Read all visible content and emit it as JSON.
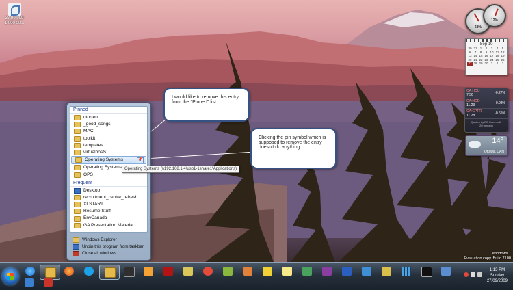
{
  "desktop": {
    "icon_caption_1": "37 99 999",
    "icon_caption_2": "1 000 00..."
  },
  "jumplist": {
    "pinned_header": "Pinned",
    "pinned": [
      "utorrent",
      "_good_songs",
      "MAC",
      "toolkit",
      "templates",
      "virtualhosts",
      "Operating Systems",
      "Operating Systems",
      "OPS"
    ],
    "frequent_header": "Frequent",
    "frequent": [
      "Desktop",
      "recruitment_centre_refresh",
      "XLSTART",
      "Resume Stuff",
      "EnvCanada",
      "GA Presentation Material"
    ],
    "tasks": [
      "Windows Explorer",
      "Unpin this program from taskbar",
      "Close all windows"
    ],
    "pin_glyph": "📌"
  },
  "tooltip": "Operating Systems (\\\\192.168.1.4\\usb1-1share1\\Applications)",
  "callouts": {
    "first": "I would like to remove this entry from the \"Pinned\" list.",
    "second": "Clicking the pin symbol which is supposed to remove the entry doesn't do anything."
  },
  "gadgets": {
    "gauge1_label": "68%",
    "gauge2_label": "12%",
    "calendar_header": "Sep 10",
    "calendar_days": [
      "30",
      "31",
      "1",
      "2",
      "3",
      "4",
      "5",
      "6",
      "7",
      "8",
      "9",
      "10",
      "11",
      "12",
      "13",
      "14",
      "15",
      "16",
      "17",
      "18",
      "19",
      "20",
      "21",
      "22",
      "23",
      "24",
      "25",
      "26",
      "27",
      "28",
      "29",
      "30",
      "1",
      "2",
      "3"
    ],
    "stocks": [
      {
        "symbol": "CA:HOU",
        "price": "7.56",
        "pct": "-0.27%"
      },
      {
        "symbol": "CA:HOD",
        "price": "11.23",
        "pct": "-0.08%"
      },
      {
        "symbol": "CA:CPTR",
        "price": "11.28",
        "pct": "-0.65%"
      }
    ],
    "stocks_footer": "Quotes by BC Commodit",
    "stocks_time": "20 min ago",
    "weather_temp": "14°",
    "weather_city": "Ottawa, CAN"
  },
  "watermark": {
    "line1": "Windows 7",
    "line2": "Evaluation copy. Build 7100"
  },
  "taskbar": {
    "time": "1:13 PM",
    "day": "Sunday",
    "date": "27/09/2009"
  },
  "colors": {
    "callout_border": "#365282",
    "highlight": "#c8dff8",
    "pinned_header": "#1c3a8e"
  }
}
